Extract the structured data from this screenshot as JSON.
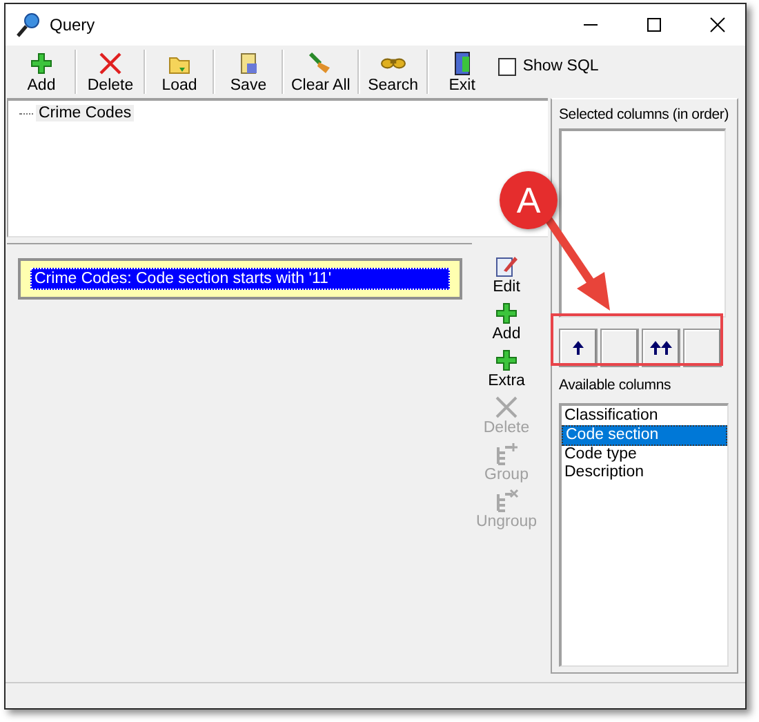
{
  "window": {
    "title": "Query"
  },
  "toolbar": {
    "buttons": [
      {
        "label": "Add",
        "kind": "add"
      },
      {
        "label": "Delete",
        "kind": "delete"
      },
      {
        "label": "Load",
        "kind": "load"
      },
      {
        "label": "Save",
        "kind": "save"
      },
      {
        "label": "Clear All",
        "kind": "clear"
      },
      {
        "label": "Search",
        "kind": "search"
      },
      {
        "label": "Exit",
        "kind": "exit"
      }
    ],
    "show_sql": {
      "label": "Show SQL",
      "checked": false
    }
  },
  "tree": {
    "items": [
      {
        "label": "Crime Codes"
      }
    ]
  },
  "criteria": [
    {
      "text": "Crime Codes: Code section starts with '11'",
      "selected": true
    }
  ],
  "side_buttons": [
    {
      "label": "Edit",
      "kind": "edit",
      "disabled": false
    },
    {
      "label": "Add",
      "kind": "add",
      "disabled": false
    },
    {
      "label": "Extra",
      "kind": "add",
      "disabled": false
    },
    {
      "label": "Delete",
      "kind": "delete",
      "disabled": true
    },
    {
      "label": "Group",
      "kind": "group",
      "disabled": true
    },
    {
      "label": "Ungroup",
      "kind": "ungroup",
      "disabled": true
    }
  ],
  "selected_columns": {
    "label": "Selected columns (in order)"
  },
  "order_buttons": [
    {
      "kind": "up"
    },
    {
      "kind": "blank"
    },
    {
      "kind": "top"
    },
    {
      "kind": "blank"
    }
  ],
  "available_columns": {
    "label": "Available columns",
    "items": [
      {
        "label": "Classification",
        "selected": false
      },
      {
        "label": "Code section",
        "selected": true
      },
      {
        "label": "Code type",
        "selected": false
      },
      {
        "label": "Description",
        "selected": false
      }
    ]
  },
  "annotation": {
    "label": "A"
  }
}
